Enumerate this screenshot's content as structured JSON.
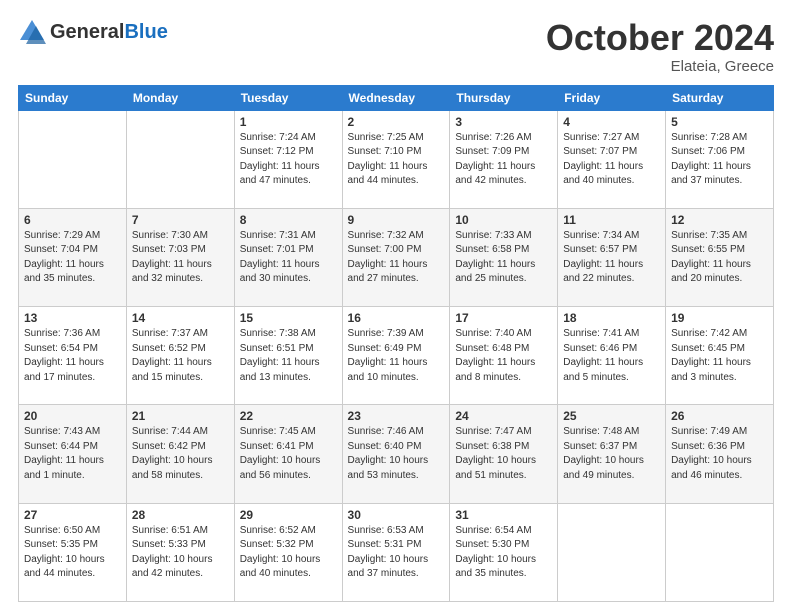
{
  "header": {
    "logo_general": "General",
    "logo_blue": "Blue",
    "month_title": "October 2024",
    "location": "Elateia, Greece"
  },
  "days_of_week": [
    "Sunday",
    "Monday",
    "Tuesday",
    "Wednesday",
    "Thursday",
    "Friday",
    "Saturday"
  ],
  "weeks": [
    [
      {
        "day": null,
        "sunrise": null,
        "sunset": null,
        "daylight": null
      },
      {
        "day": null,
        "sunrise": null,
        "sunset": null,
        "daylight": null
      },
      {
        "day": "1",
        "sunrise": "Sunrise: 7:24 AM",
        "sunset": "Sunset: 7:12 PM",
        "daylight": "Daylight: 11 hours and 47 minutes."
      },
      {
        "day": "2",
        "sunrise": "Sunrise: 7:25 AM",
        "sunset": "Sunset: 7:10 PM",
        "daylight": "Daylight: 11 hours and 44 minutes."
      },
      {
        "day": "3",
        "sunrise": "Sunrise: 7:26 AM",
        "sunset": "Sunset: 7:09 PM",
        "daylight": "Daylight: 11 hours and 42 minutes."
      },
      {
        "day": "4",
        "sunrise": "Sunrise: 7:27 AM",
        "sunset": "Sunset: 7:07 PM",
        "daylight": "Daylight: 11 hours and 40 minutes."
      },
      {
        "day": "5",
        "sunrise": "Sunrise: 7:28 AM",
        "sunset": "Sunset: 7:06 PM",
        "daylight": "Daylight: 11 hours and 37 minutes."
      }
    ],
    [
      {
        "day": "6",
        "sunrise": "Sunrise: 7:29 AM",
        "sunset": "Sunset: 7:04 PM",
        "daylight": "Daylight: 11 hours and 35 minutes."
      },
      {
        "day": "7",
        "sunrise": "Sunrise: 7:30 AM",
        "sunset": "Sunset: 7:03 PM",
        "daylight": "Daylight: 11 hours and 32 minutes."
      },
      {
        "day": "8",
        "sunrise": "Sunrise: 7:31 AM",
        "sunset": "Sunset: 7:01 PM",
        "daylight": "Daylight: 11 hours and 30 minutes."
      },
      {
        "day": "9",
        "sunrise": "Sunrise: 7:32 AM",
        "sunset": "Sunset: 7:00 PM",
        "daylight": "Daylight: 11 hours and 27 minutes."
      },
      {
        "day": "10",
        "sunrise": "Sunrise: 7:33 AM",
        "sunset": "Sunset: 6:58 PM",
        "daylight": "Daylight: 11 hours and 25 minutes."
      },
      {
        "day": "11",
        "sunrise": "Sunrise: 7:34 AM",
        "sunset": "Sunset: 6:57 PM",
        "daylight": "Daylight: 11 hours and 22 minutes."
      },
      {
        "day": "12",
        "sunrise": "Sunrise: 7:35 AM",
        "sunset": "Sunset: 6:55 PM",
        "daylight": "Daylight: 11 hours and 20 minutes."
      }
    ],
    [
      {
        "day": "13",
        "sunrise": "Sunrise: 7:36 AM",
        "sunset": "Sunset: 6:54 PM",
        "daylight": "Daylight: 11 hours and 17 minutes."
      },
      {
        "day": "14",
        "sunrise": "Sunrise: 7:37 AM",
        "sunset": "Sunset: 6:52 PM",
        "daylight": "Daylight: 11 hours and 15 minutes."
      },
      {
        "day": "15",
        "sunrise": "Sunrise: 7:38 AM",
        "sunset": "Sunset: 6:51 PM",
        "daylight": "Daylight: 11 hours and 13 minutes."
      },
      {
        "day": "16",
        "sunrise": "Sunrise: 7:39 AM",
        "sunset": "Sunset: 6:49 PM",
        "daylight": "Daylight: 11 hours and 10 minutes."
      },
      {
        "day": "17",
        "sunrise": "Sunrise: 7:40 AM",
        "sunset": "Sunset: 6:48 PM",
        "daylight": "Daylight: 11 hours and 8 minutes."
      },
      {
        "day": "18",
        "sunrise": "Sunrise: 7:41 AM",
        "sunset": "Sunset: 6:46 PM",
        "daylight": "Daylight: 11 hours and 5 minutes."
      },
      {
        "day": "19",
        "sunrise": "Sunrise: 7:42 AM",
        "sunset": "Sunset: 6:45 PM",
        "daylight": "Daylight: 11 hours and 3 minutes."
      }
    ],
    [
      {
        "day": "20",
        "sunrise": "Sunrise: 7:43 AM",
        "sunset": "Sunset: 6:44 PM",
        "daylight": "Daylight: 11 hours and 1 minute."
      },
      {
        "day": "21",
        "sunrise": "Sunrise: 7:44 AM",
        "sunset": "Sunset: 6:42 PM",
        "daylight": "Daylight: 10 hours and 58 minutes."
      },
      {
        "day": "22",
        "sunrise": "Sunrise: 7:45 AM",
        "sunset": "Sunset: 6:41 PM",
        "daylight": "Daylight: 10 hours and 56 minutes."
      },
      {
        "day": "23",
        "sunrise": "Sunrise: 7:46 AM",
        "sunset": "Sunset: 6:40 PM",
        "daylight": "Daylight: 10 hours and 53 minutes."
      },
      {
        "day": "24",
        "sunrise": "Sunrise: 7:47 AM",
        "sunset": "Sunset: 6:38 PM",
        "daylight": "Daylight: 10 hours and 51 minutes."
      },
      {
        "day": "25",
        "sunrise": "Sunrise: 7:48 AM",
        "sunset": "Sunset: 6:37 PM",
        "daylight": "Daylight: 10 hours and 49 minutes."
      },
      {
        "day": "26",
        "sunrise": "Sunrise: 7:49 AM",
        "sunset": "Sunset: 6:36 PM",
        "daylight": "Daylight: 10 hours and 46 minutes."
      }
    ],
    [
      {
        "day": "27",
        "sunrise": "Sunrise: 6:50 AM",
        "sunset": "Sunset: 5:35 PM",
        "daylight": "Daylight: 10 hours and 44 minutes."
      },
      {
        "day": "28",
        "sunrise": "Sunrise: 6:51 AM",
        "sunset": "Sunset: 5:33 PM",
        "daylight": "Daylight: 10 hours and 42 minutes."
      },
      {
        "day": "29",
        "sunrise": "Sunrise: 6:52 AM",
        "sunset": "Sunset: 5:32 PM",
        "daylight": "Daylight: 10 hours and 40 minutes."
      },
      {
        "day": "30",
        "sunrise": "Sunrise: 6:53 AM",
        "sunset": "Sunset: 5:31 PM",
        "daylight": "Daylight: 10 hours and 37 minutes."
      },
      {
        "day": "31",
        "sunrise": "Sunrise: 6:54 AM",
        "sunset": "Sunset: 5:30 PM",
        "daylight": "Daylight: 10 hours and 35 minutes."
      },
      {
        "day": null,
        "sunrise": null,
        "sunset": null,
        "daylight": null
      },
      {
        "day": null,
        "sunrise": null,
        "sunset": null,
        "daylight": null
      }
    ]
  ]
}
